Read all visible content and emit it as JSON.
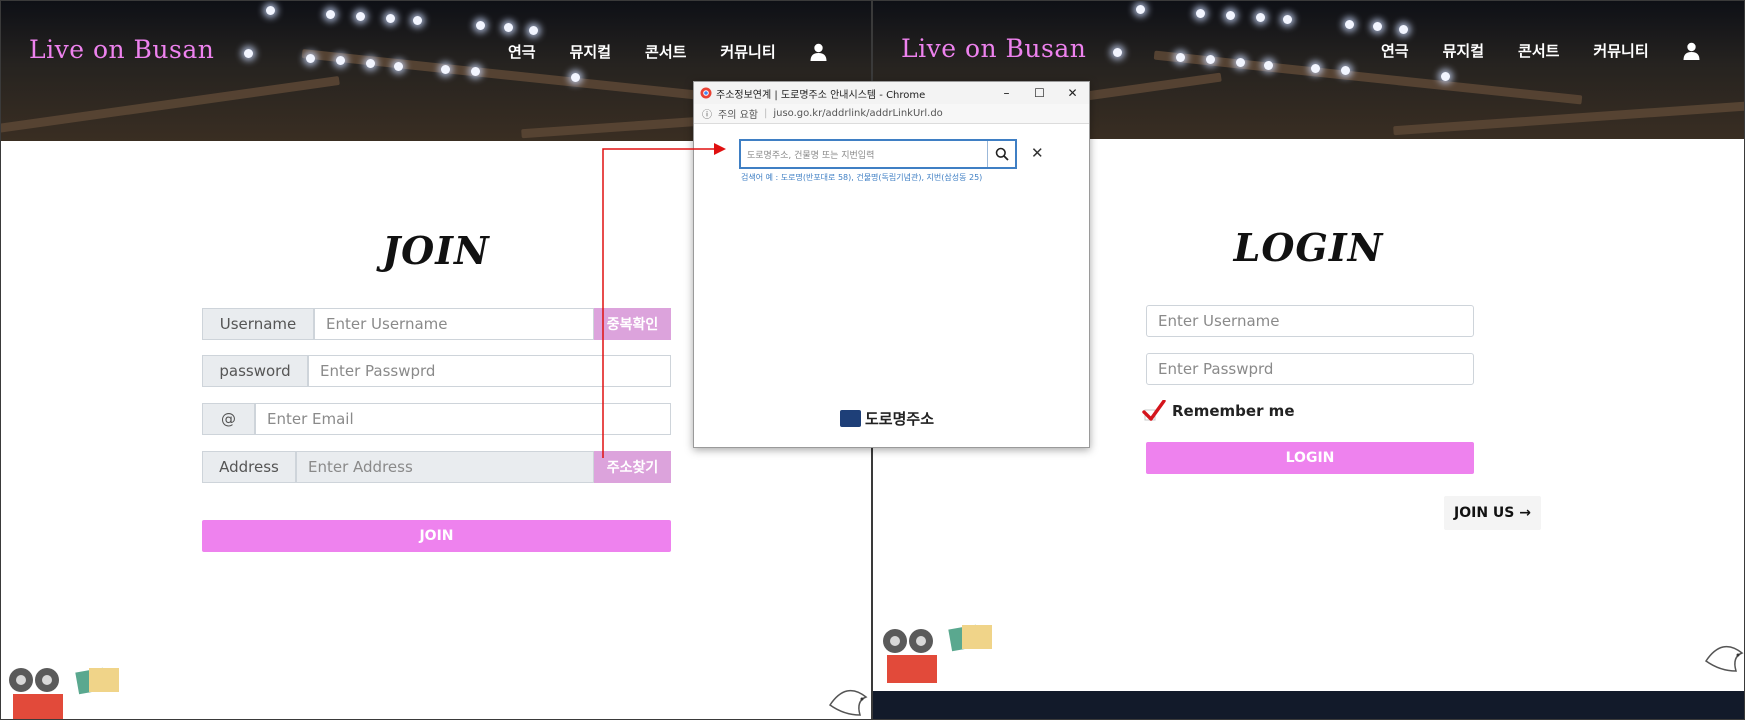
{
  "join_page": {
    "site_logo": "Live on Busan",
    "nav": [
      "연극",
      "뮤지컬",
      "콘서트",
      "커뮤니티"
    ],
    "title": "JOIN",
    "username": {
      "label": "Username",
      "placeholder": "Enter Username",
      "check_button": "중복확인"
    },
    "password": {
      "label": "password",
      "placeholder": "Enter Passwprd"
    },
    "email": {
      "label": "@",
      "placeholder": "Enter Email"
    },
    "address": {
      "label": "Address",
      "placeholder": "Enter Address",
      "find_button": "주소찾기"
    },
    "submit": "JOIN"
  },
  "popup": {
    "window_title": "주소정보연계 | 도로명주소 안내시스템 - Chrome",
    "security_label": "주의 요함",
    "url": "juso.go.kr/addrlink/addrLinkUrl.do",
    "search_placeholder": "도로명주소, 건물명 또는 지번입력",
    "hint": "검색어 예 : 도로명(반포대로 58), 건물명(독립기념관), 지번(삼성동 25)",
    "footer": "도로명주소"
  },
  "login_page": {
    "site_logo": "Live on Busan",
    "nav": [
      "연극",
      "뮤지컬",
      "콘서트",
      "커뮤니티"
    ],
    "title": "LOGIN",
    "username_placeholder": "Enter Username",
    "password_placeholder": "Enter Passwprd",
    "remember_label": "Remember me",
    "remember_checked": true,
    "submit": "LOGIN",
    "join_us": "JOIN US →"
  },
  "colors": {
    "accent": "#ee82ee",
    "accent_muted": "#dca3dc",
    "popup_blue": "#3f7fc4",
    "annotation_red": "#e01010"
  },
  "icons": [
    "user-icon",
    "search-icon",
    "close-icon",
    "checkmark-icon",
    "film-camera-icon",
    "ticket-icon",
    "bird-icon"
  ]
}
